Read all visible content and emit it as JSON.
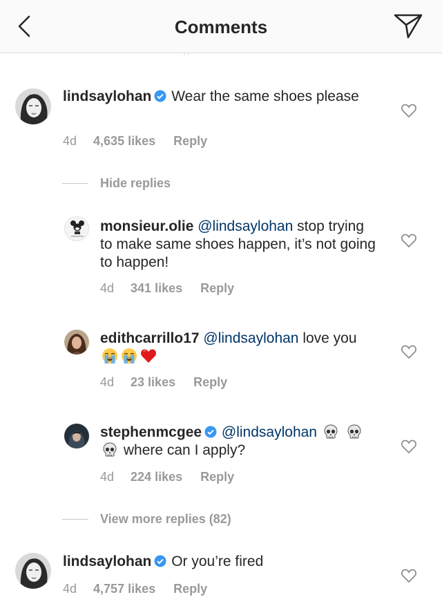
{
  "header": {
    "title": "Comments"
  },
  "comments": [
    {
      "username": "lindsaylohan",
      "text": "Wear the same shoes please",
      "time": "4d",
      "likes": "4,635 likes",
      "reply": "Reply",
      "hide_replies": "Hide replies",
      "replies": [
        {
          "username": "monsieur.olie",
          "mention": "@lindsaylohan",
          "text": " stop trying to make same shoes happen, it’s not going to happen!",
          "time": "4d",
          "likes": "341 likes",
          "reply": "Reply"
        },
        {
          "username": "edithcarrillo17",
          "mention": "@lindsaylohan",
          "text": " love you",
          "time": "4d",
          "likes": "23 likes",
          "reply": "Reply"
        },
        {
          "username": "stephenmcgee",
          "mention": "@lindsaylohan",
          "text": "where can I apply?",
          "time": "4d",
          "likes": "224 likes",
          "reply": "Reply"
        }
      ],
      "view_more": "View more replies (82)"
    },
    {
      "username": "lindsaylohan",
      "text": "Or you’re fired",
      "time": "4d",
      "likes": "4,757 likes",
      "reply": "Reply"
    }
  ],
  "icons": {
    "back": "chevron-left-icon",
    "send": "paper-plane-icon",
    "heart": "heart-outline-icon",
    "verified": "verified-badge-icon",
    "crying": "loudly-crying-face-emoji",
    "red_heart": "red-heart-emoji",
    "skull": "skull-emoji"
  },
  "colors": {
    "mention": "#003569",
    "verified": "#3897f0",
    "meta": "#999999"
  }
}
